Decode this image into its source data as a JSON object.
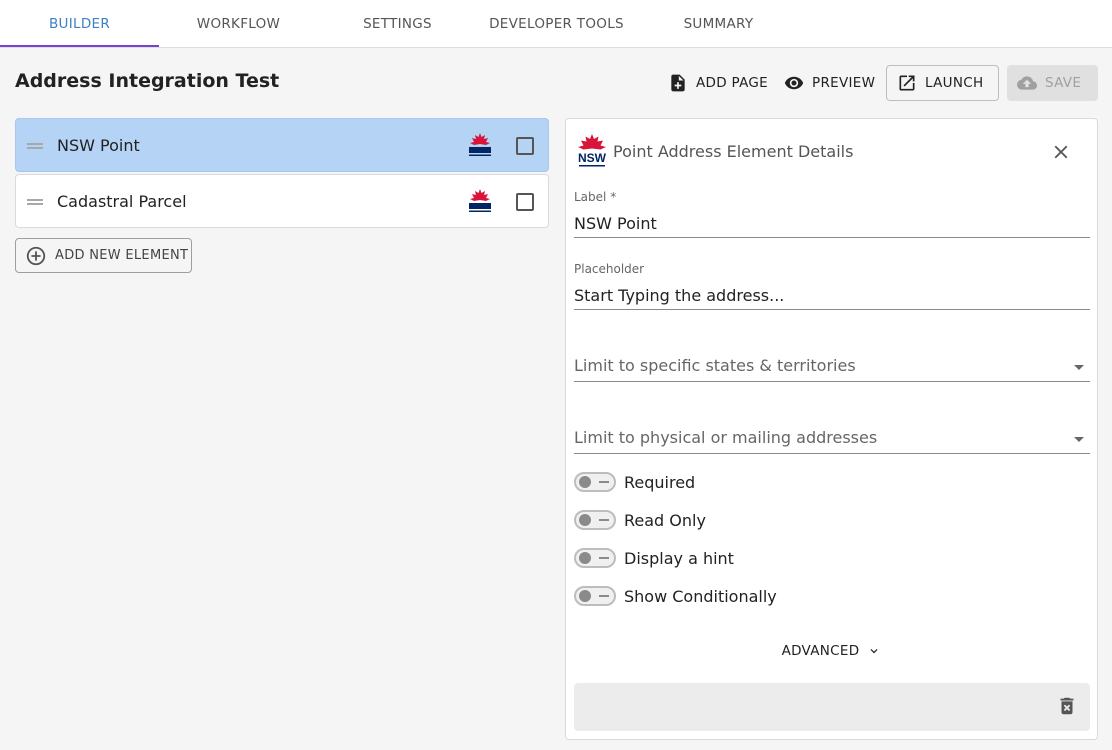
{
  "tabs": [
    {
      "label": "BUILDER"
    },
    {
      "label": "WORKFLOW"
    },
    {
      "label": "SETTINGS"
    },
    {
      "label": "DEVELOPER TOOLS"
    },
    {
      "label": "SUMMARY"
    }
  ],
  "header": {
    "title": "Address Integration Test",
    "add_page": "ADD PAGE",
    "preview": "PREVIEW",
    "launch": "LAUNCH",
    "save": "SAVE"
  },
  "elements": [
    {
      "label": "NSW Point",
      "selected": true
    },
    {
      "label": "Cadastral Parcel",
      "selected": false
    }
  ],
  "add_element_label": "ADD NEW ELEMENT",
  "details": {
    "title": "Point Address Element Details",
    "label_field": {
      "label": "Label *",
      "value": "NSW Point"
    },
    "placeholder_field": {
      "label": "Placeholder",
      "value": "Start Typing the address..."
    },
    "states_select": {
      "placeholder": "Limit to specific states & territories"
    },
    "address_type_select": {
      "placeholder": "Limit to physical or mailing addresses"
    },
    "toggles": [
      {
        "label": "Required",
        "on": false
      },
      {
        "label": "Read Only",
        "on": false
      },
      {
        "label": "Display a hint",
        "on": false
      },
      {
        "label": "Show Conditionally",
        "on": false
      }
    ],
    "advanced_label": "ADVANCED"
  },
  "logo": {
    "text": "NSW"
  },
  "colors": {
    "accent_blue": "#3f7fc4",
    "tab_indicator": "#7b3fd1",
    "selected_row": "#b5d4f5",
    "nsw_red": "#d7153a",
    "nsw_navy": "#002664"
  },
  "icons": {
    "add_page": "note-add-icon",
    "preview": "eye-icon",
    "launch": "open-in-new-icon",
    "save": "cloud-upload-icon",
    "close": "close-icon",
    "delete": "delete-forever-icon",
    "add": "add-circle-outline-icon",
    "chevron": "chevron-down-icon"
  }
}
